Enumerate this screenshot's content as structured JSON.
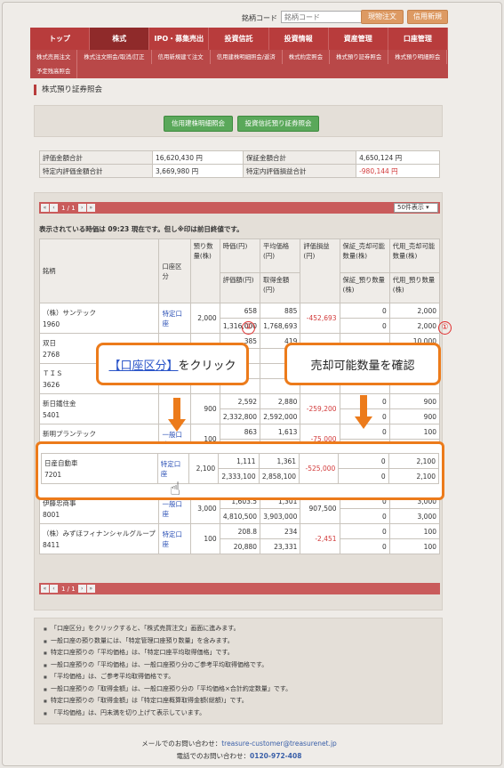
{
  "header": {
    "search_label": "銘柄コード",
    "search_placeholder": "銘柄コード",
    "btn_spot": "現物注文",
    "btn_margin": "信用新規"
  },
  "mainnav": [
    "トップ",
    "株式",
    "IPO・募集売出",
    "投資信託",
    "投資情報",
    "資産管理",
    "口座管理"
  ],
  "subnav": [
    "株式売買注文",
    "株式注文照会/取消/訂正",
    "信用新規建て注文",
    "信用建株明細照会/返済",
    "株式約定照会",
    "株式預り証券照会",
    "株式預り明細照会",
    "予定残高照会"
  ],
  "section_title": "株式預り証券照会",
  "buttons": {
    "margin_detail": "信用建株明細照会",
    "fund_detail": "投資信託預り証券照会"
  },
  "summary": {
    "row1": [
      "評価金額合計",
      "16,620,430 円",
      "保証金額合計",
      "4,650,124 円"
    ],
    "row2": [
      "特定内評価金額合計",
      "3,669,980 円",
      "特定内評価損益合計",
      "-980,144 円"
    ]
  },
  "pager": {
    "text": "1 / 1",
    "per_page": "50件表示 ▾"
  },
  "time_note": "表示されている時価は 09:23 現在です。但し※印は前日終値です。",
  "table_headers": {
    "name": "銘柄",
    "account": "口座区分",
    "qty": "預り数量(株)",
    "price": "時価(円)",
    "avg": "平均価格(円)",
    "eval": "評価額(円)",
    "acq": "取得金額(円)",
    "pl": "評価損益(円)",
    "hosho": "保証_売却可能数量(株)",
    "hosho2": "保証_預り数量(株)",
    "daiyo": "代用_売却可能数量(株)",
    "daiyo2": "代用_預り数量(株)"
  },
  "rows": [
    {
      "name": "（株）サンテック",
      "code": "1960",
      "account": "特定口座",
      "qty": "2,000",
      "price": "658",
      "avg": "885",
      "eval": "1,316,000",
      "acq": "1,768,693",
      "pl": "-452,693",
      "h1": "0",
      "h2": "0",
      "d1": "2,000",
      "d2": "2,000"
    },
    {
      "name": "双日",
      "code": "2768",
      "account": "",
      "qty": "",
      "price": "385",
      "avg": "419",
      "eval": "",
      "acq": "",
      "pl": "",
      "h1": "",
      "h2": "",
      "d1": "10,000",
      "d2": ""
    },
    {
      "name": "ＴＩＳ",
      "code": "3626",
      "account": "",
      "qty": "",
      "price": "",
      "avg": "",
      "eval": "",
      "acq": "",
      "pl": "",
      "h1": "",
      "h2": "",
      "d1": "",
      "d2": ""
    },
    {
      "name": "新日鐵住金",
      "code": "5401",
      "account": "",
      "qty": "900",
      "price": "2,592",
      "avg": "2,880",
      "eval": "2,332,800",
      "acq": "2,592,000",
      "pl": "-259,200",
      "h1": "0",
      "h2": "0",
      "d1": "900",
      "d2": "900"
    },
    {
      "name": "新明プランテック",
      "code": "6379",
      "account": "一般口座",
      "qty": "100",
      "price": "863",
      "avg": "1,613",
      "eval": "",
      "acq": "",
      "pl": "-75,000",
      "h1": "0",
      "h2": "",
      "d1": "100",
      "d2": ""
    },
    {
      "name": "伊藤忠商事",
      "code": "8001",
      "account": "一般口座",
      "qty": "3,000",
      "price": "1,603.5",
      "avg": "1,301",
      "eval": "4,810,500",
      "acq": "3,903,000",
      "pl": "907,500",
      "h1": "0",
      "h2": "0",
      "d1": "3,000",
      "d2": "3,000"
    },
    {
      "name": "（株）みずほフィナンシャルグループ",
      "code": "8411",
      "account": "特定口座",
      "qty": "100",
      "price": "208.8",
      "avg": "234",
      "eval": "20,880",
      "acq": "23,331",
      "pl": "-2,451",
      "h1": "0",
      "h2": "0",
      "d1": "100",
      "d2": "100"
    }
  ],
  "highlight_row": {
    "name": "日産自動車",
    "code": "7201",
    "account": "特定口座",
    "qty": "2,100",
    "price": "1,111",
    "avg": "1,361",
    "eval": "2,333,100",
    "acq": "2,858,100",
    "pl": "-525,000",
    "h1": "0",
    "h2": "0",
    "d1": "2,100",
    "d2": "2,100"
  },
  "callout1": {
    "link": "【口座区分】",
    "text": "をクリック"
  },
  "callout2": "売却可能数量を確認",
  "badge1": "①",
  "badge2": "②",
  "notes": [
    "「口座区分」をクリックすると、「株式売買注文」画面に進みます。",
    "一般口座の預り数量には、「特定管理口座預り数量」を含みます。",
    "特定口座預りの「平均価格」は、「特定口座平均取得価格」です。",
    "一般口座預りの「平均価格」は、一般口座預り分のご参考平均取得価格です。",
    "「平均価格」は、ご参考平均取得価格です。",
    "一般口座預りの「取得金額」は、一般口座預り分の「平均価格×合計約定数量」です。",
    "特定口座預りの「取得金額」は「特定口座概算取得金額(総額)」です。",
    "「平均価格」は、円未満を切り上げて表示しています。"
  ],
  "footer": {
    "mail_label": "メールでのお問い合わせ：",
    "mail": "treasure-customer@treasurenet.jp",
    "tel_label": "電話でのお問い合わせ：",
    "tel": "0120-972-408"
  }
}
